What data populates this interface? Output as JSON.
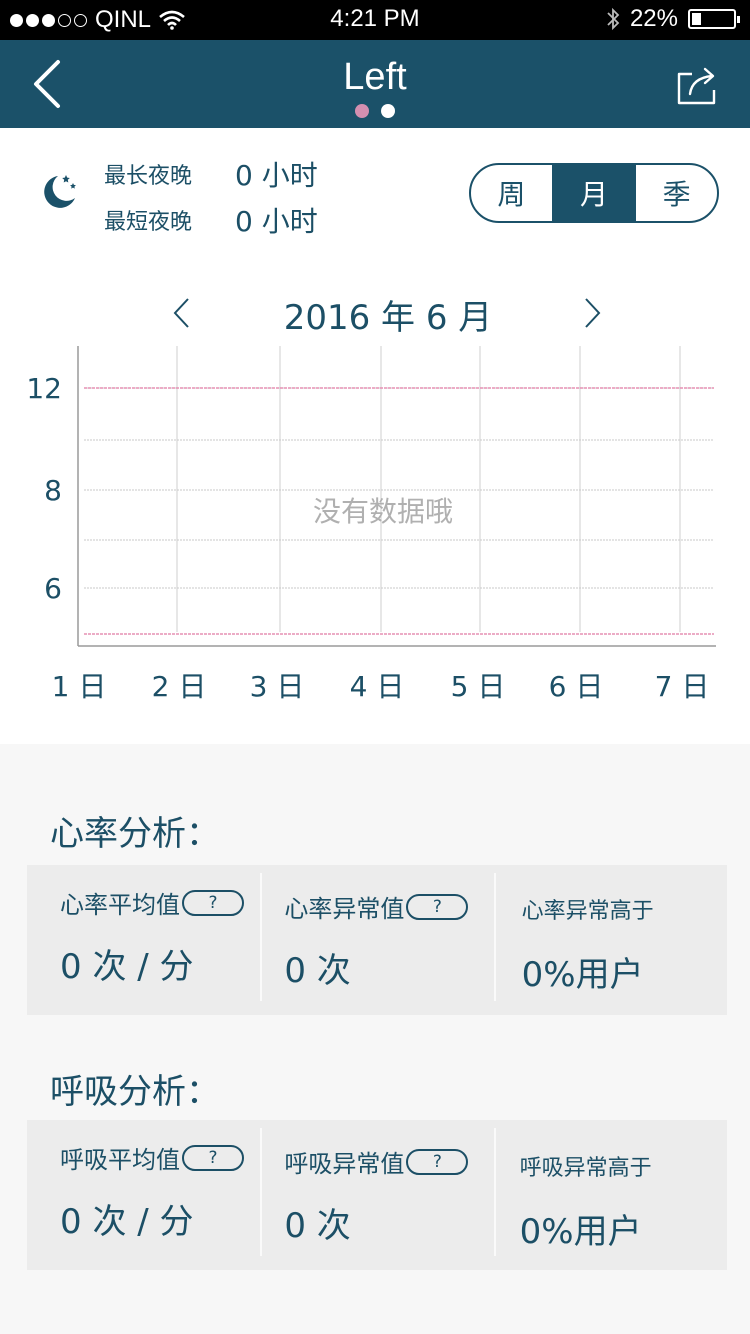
{
  "status_bar": {
    "carrier": "QINL",
    "time": "4:21 PM",
    "battery_percent": "22%",
    "battery_level": 0.22,
    "signal_bars": 3,
    "signal_total": 5,
    "icons": [
      "wifi-icon",
      "bluetooth-icon",
      "battery-icon"
    ]
  },
  "nav": {
    "title": "Left",
    "page_count": 2,
    "active_page": 1,
    "dot_colors": {
      "active": "#d48fb0",
      "inactive": "#ffffff"
    },
    "icons": {
      "back": "chevron-left-icon",
      "share": "share-icon"
    },
    "color": "#1b5169"
  },
  "sleep": {
    "longest_label": "最长夜晚",
    "longest_value": "0 小时",
    "shortest_label": "最短夜晚",
    "shortest_value": "0 小时",
    "icon": "moon-stars-icon"
  },
  "period_selector": {
    "options": [
      "周",
      "月",
      "季"
    ],
    "selected": "月"
  },
  "month": {
    "title": "2016 年 6 月",
    "prev_icon": "chevron-left-icon",
    "next_icon": "chevron-right-icon"
  },
  "chart_data": {
    "type": "line",
    "categories": [
      "1 日",
      "2 日",
      "3 日",
      "4 日",
      "5 日",
      "6 日",
      "7 日"
    ],
    "y_ticks": [
      {
        "value": 12,
        "label": "12"
      },
      {
        "value": 8,
        "label": "8"
      },
      {
        "value": 6,
        "label": "6"
      }
    ],
    "reference_lines": [
      12,
      4
    ],
    "reference_color": "#e590b4",
    "grid": true,
    "series": [],
    "empty_message": "没有数据哦"
  },
  "heart": {
    "title": "心率分析：",
    "avg_label": "心率平均值",
    "avg_value": "0 次 / 分",
    "abnormal_label": "心率异常值",
    "abnormal_value": "0 次",
    "higher_label": "心率异常高于",
    "higher_value": "0%用户",
    "help": "?"
  },
  "breath": {
    "title": "呼吸分析：",
    "avg_label": "呼吸平均值",
    "avg_value": "0 次 / 分",
    "abnormal_label": "呼吸异常值",
    "abnormal_value": "0 次",
    "higher_label": "呼吸异常高于",
    "higher_value": "0%用户",
    "help": "?"
  }
}
